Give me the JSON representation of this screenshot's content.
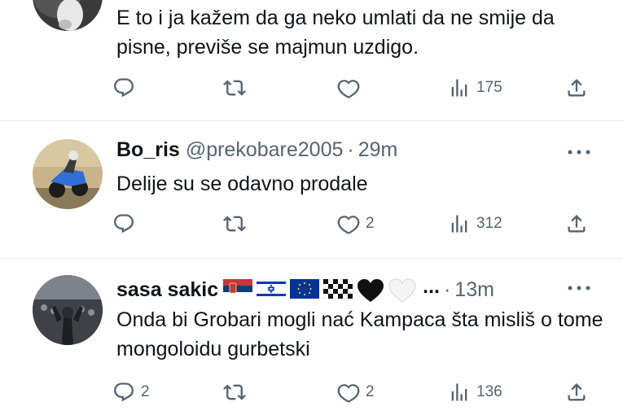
{
  "tweets": [
    {
      "name": "",
      "handle": "",
      "time": "",
      "text": "E to i ja kažem da ga neko umlati da ne smije da pisne, previše se majmun uzdigo.",
      "replies": "",
      "retweets": "",
      "likes": "",
      "views": "175"
    },
    {
      "name": "Bo_ris",
      "handle": "@prekobare2005",
      "separator": "·",
      "time": "29m",
      "text": "Delije su se odavno prodale",
      "replies": "",
      "retweets": "",
      "likes": "2",
      "views": "312"
    },
    {
      "name": "sasa sakic",
      "emojis": [
        "serbia-flag",
        "israel-flag",
        "eu-flag",
        "checkered-flag",
        "black-heart",
        "white-heart"
      ],
      "ellipsis": "...",
      "separator": "·",
      "time": "13m",
      "text": "Onda bi Grobari mogli nać Kampaca šta mislіš o tome mongoloidu gurbetski",
      "replies": "2",
      "retweets": "",
      "likes": "2",
      "views": "136"
    }
  ],
  "colors": {
    "text": "#0f1419",
    "secondary": "#536471",
    "divider": "#e6e9ec"
  }
}
